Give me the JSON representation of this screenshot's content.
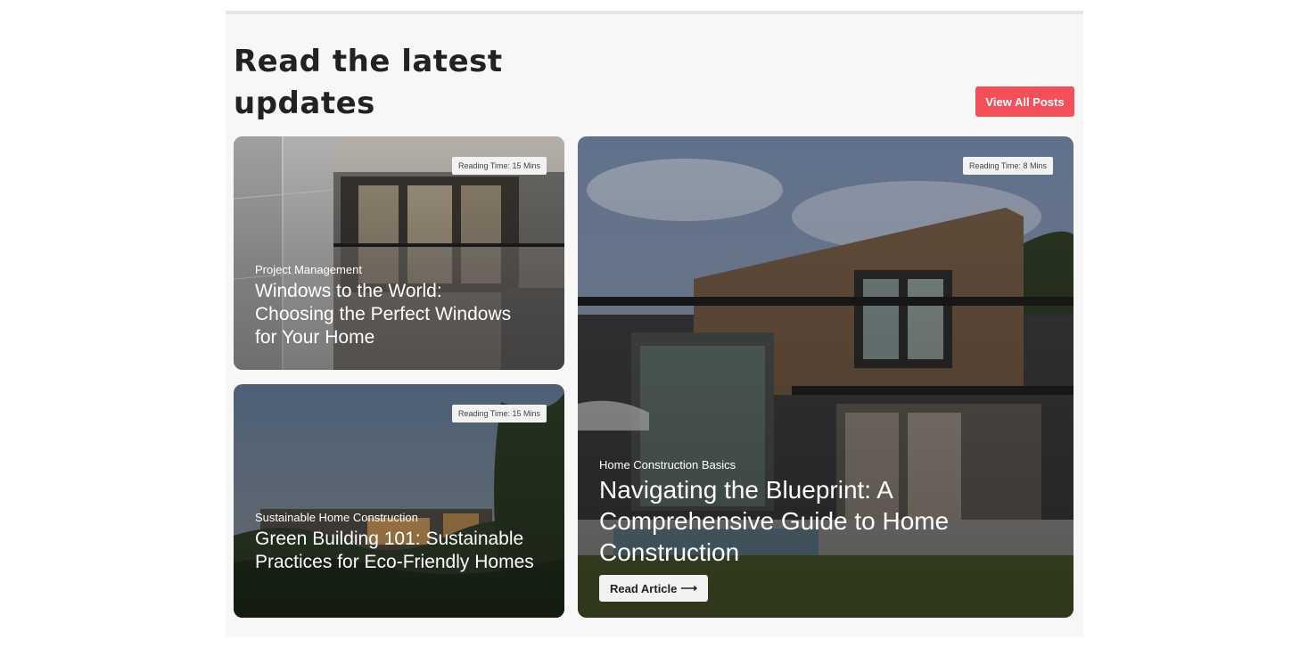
{
  "section": {
    "heading": "Read the latest updates",
    "view_all_label": "View All Posts"
  },
  "cards": [
    {
      "reading_time": "Reading Time: 15 Mins",
      "category": "Project Management",
      "title": "Windows to the World: Choosing the Perfect Windows for Your Home"
    },
    {
      "reading_time": "Reading Time: 15 Mins",
      "category": "Sustainable Home Construction",
      "title": "Green Building 101: Sustainable Practices for Eco-Friendly Homes"
    },
    {
      "reading_time": "Reading Time: 8 Mins",
      "category": "Home Construction Basics",
      "title": "Navigating the Blueprint: A Comprehensive Guide to Home Construction",
      "cta_label": "Read Article",
      "cta_arrow": "⟶"
    }
  ],
  "colors": {
    "accent": "#f4505a",
    "heading_text": "#222222",
    "section_bg": "#f7f7f7"
  }
}
